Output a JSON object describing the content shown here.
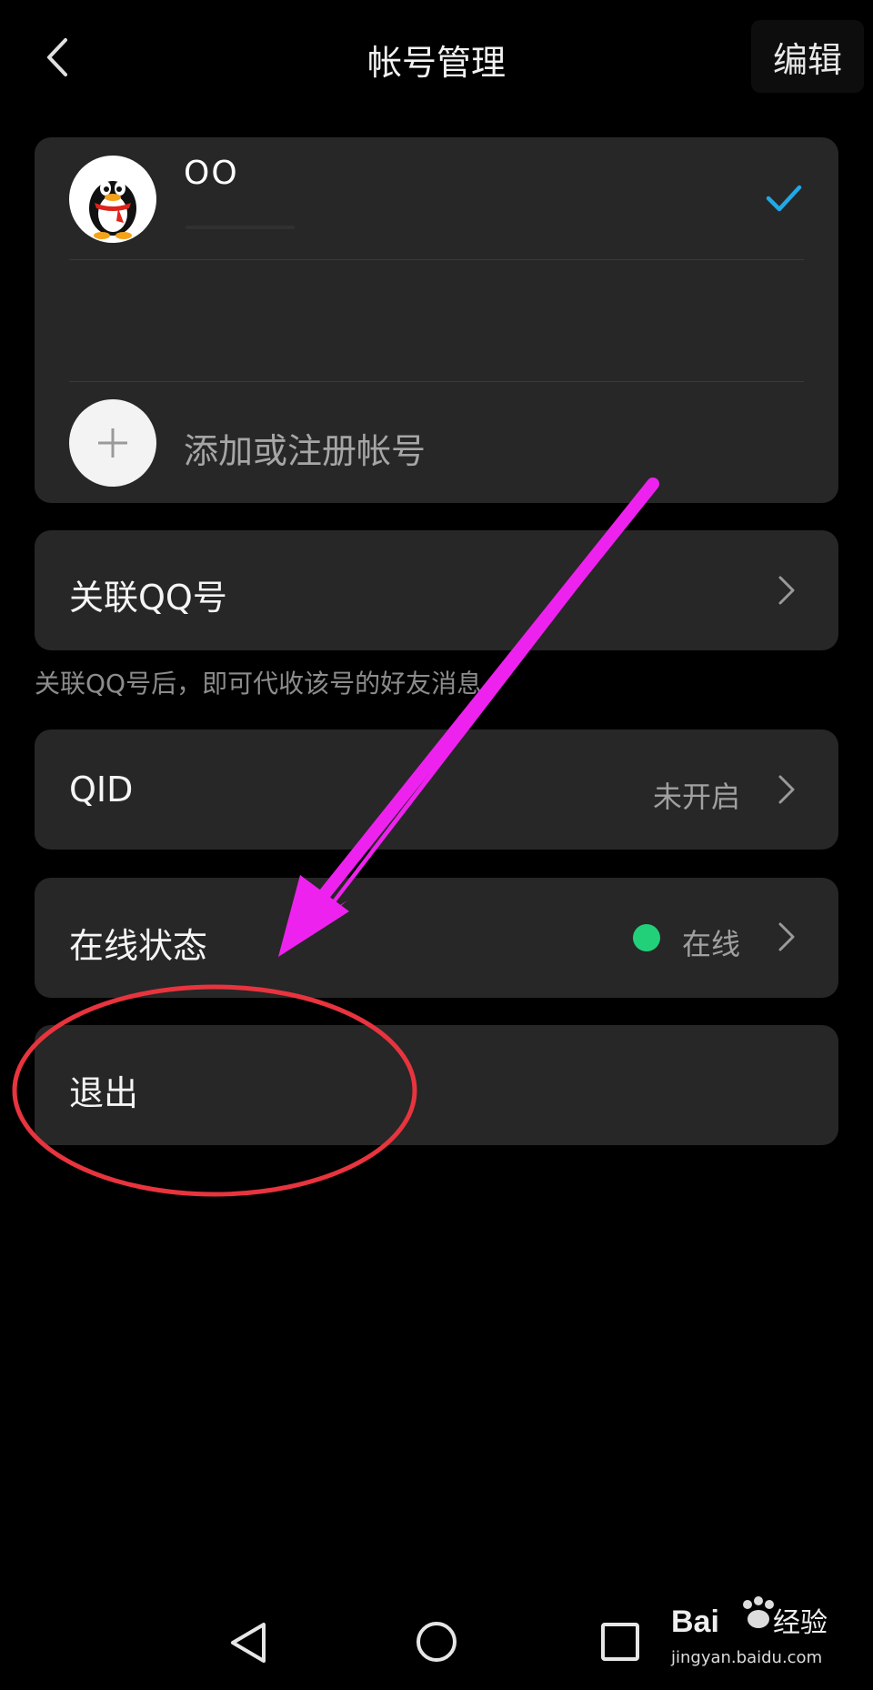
{
  "header": {
    "title": "帐号管理",
    "edit_label": "编辑"
  },
  "accounts": [
    {
      "name": "OO",
      "selected": true
    }
  ],
  "add_account_label": "添加或注册帐号",
  "settings": {
    "linked_qq": {
      "label": "关联QQ号",
      "note": "关联QQ号后，即可代收该号的好友消息。"
    },
    "qid": {
      "label": "QID",
      "value": "未开启"
    },
    "online_status": {
      "label": "在线状态",
      "value": "在线",
      "dot_color": "#22d07a"
    },
    "logout": {
      "label": "退出"
    }
  },
  "nav_bar": {
    "buttons": [
      "back-triangle-icon",
      "home-circle-icon",
      "recents-square-icon"
    ]
  },
  "watermark": {
    "brand": "Bai 经验",
    "url": "jingyan.baidu.com"
  },
  "annotation_colors": {
    "arrow": "#ee22ee",
    "ellipse": "#e8343e"
  }
}
